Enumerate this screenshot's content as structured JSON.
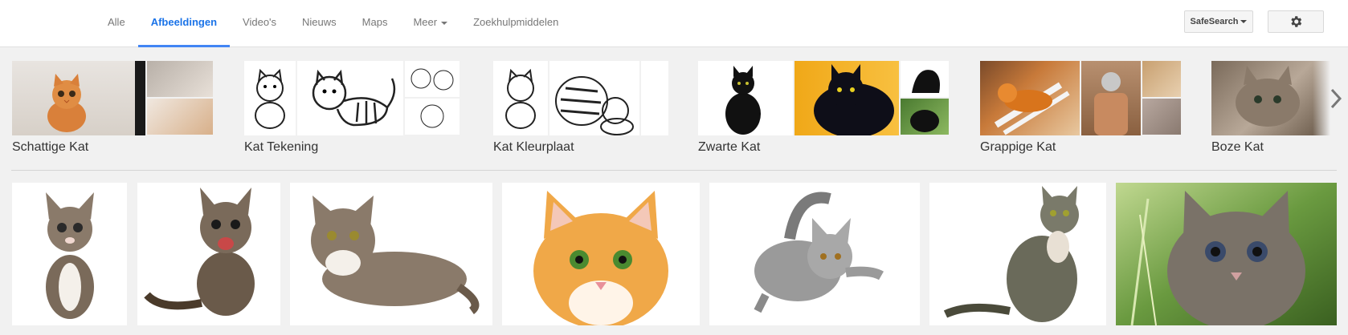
{
  "nav": {
    "tabs": [
      {
        "label": "Alle",
        "active": false
      },
      {
        "label": "Afbeeldingen",
        "active": true
      },
      {
        "label": "Video's",
        "active": false
      },
      {
        "label": "Nieuws",
        "active": false
      },
      {
        "label": "Maps",
        "active": false
      },
      {
        "label": "Meer",
        "active": false,
        "dropdown": true
      },
      {
        "label": "Zoekhulpmiddelen",
        "active": false
      }
    ],
    "safesearch_label": "SafeSearch",
    "settings_icon": "gear-icon"
  },
  "related": [
    {
      "label": "Schattige Kat"
    },
    {
      "label": "Kat Tekening"
    },
    {
      "label": "Kat Kleurplaat"
    },
    {
      "label": "Zwarte Kat"
    },
    {
      "label": "Grappige Kat"
    },
    {
      "label": "Boze Kat"
    }
  ],
  "results_count_visible": 7,
  "colors": {
    "accent": "#4285f4",
    "active_tab_text": "#1a73e8",
    "page_bg": "#f1f1f1"
  }
}
